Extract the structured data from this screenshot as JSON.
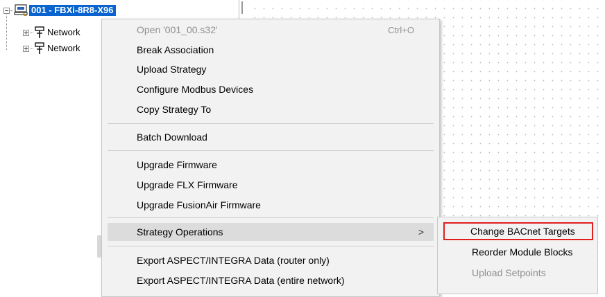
{
  "tree": {
    "root_label": "001 - FBXi-8R8-X96",
    "children": [
      {
        "label": "Network"
      },
      {
        "label": "Network"
      }
    ]
  },
  "menu": {
    "items": [
      {
        "label": "Open '001_00.s32'",
        "shortcut": "Ctrl+O",
        "disabled": true
      },
      {
        "label": "Break Association"
      },
      {
        "label": "Upload Strategy"
      },
      {
        "label": "Configure Modbus Devices"
      },
      {
        "label": "Copy Strategy To"
      },
      {
        "label": "Batch Download"
      },
      {
        "label": "Upgrade Firmware"
      },
      {
        "label": "Upgrade FLX Firmware"
      },
      {
        "label": "Upgrade FusionAir Firmware"
      },
      {
        "label": "Strategy Operations",
        "arrow": ">"
      },
      {
        "label": "Export ASPECT/INTEGRA Data (router only)"
      },
      {
        "label": "Export ASPECT/INTEGRA Data (entire network)"
      }
    ]
  },
  "submenu": {
    "items": [
      {
        "label": "Change BACnet Targets"
      },
      {
        "label": "Reorder Module Blocks"
      },
      {
        "label": "Upload Setpoints",
        "disabled": true
      }
    ]
  },
  "colors": {
    "selection": "#0a64d0",
    "highlight_border": "#e01e1e",
    "menu_bg": "#f2f2f2"
  }
}
